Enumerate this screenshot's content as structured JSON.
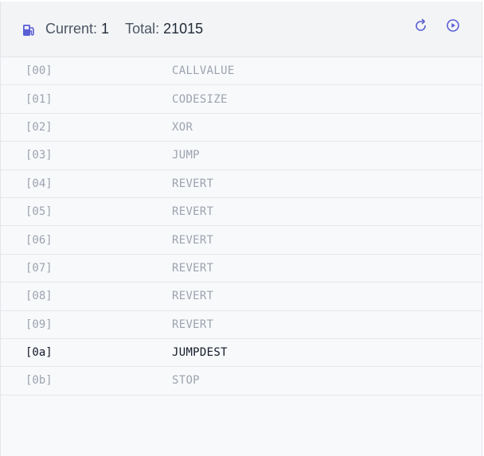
{
  "header": {
    "current_label": "Current:",
    "current_value": "1",
    "total_label": "Total:",
    "total_value": "21015",
    "icons": [
      "gas-pump-icon",
      "restart-icon",
      "play-circle-icon"
    ],
    "accent_color": "#5a5fd6"
  },
  "instructions": [
    {
      "index": "[00]",
      "opcode": "CALLVALUE",
      "active": false
    },
    {
      "index": "[01]",
      "opcode": "CODESIZE",
      "active": false
    },
    {
      "index": "[02]",
      "opcode": "XOR",
      "active": false
    },
    {
      "index": "[03]",
      "opcode": "JUMP",
      "active": false
    },
    {
      "index": "[04]",
      "opcode": "REVERT",
      "active": false
    },
    {
      "index": "[05]",
      "opcode": "REVERT",
      "active": false
    },
    {
      "index": "[06]",
      "opcode": "REVERT",
      "active": false
    },
    {
      "index": "[07]",
      "opcode": "REVERT",
      "active": false
    },
    {
      "index": "[08]",
      "opcode": "REVERT",
      "active": false
    },
    {
      "index": "[09]",
      "opcode": "REVERT",
      "active": false
    },
    {
      "index": "[0a]",
      "opcode": "JUMPDEST",
      "active": true
    },
    {
      "index": "[0b]",
      "opcode": "STOP",
      "active": false
    }
  ]
}
